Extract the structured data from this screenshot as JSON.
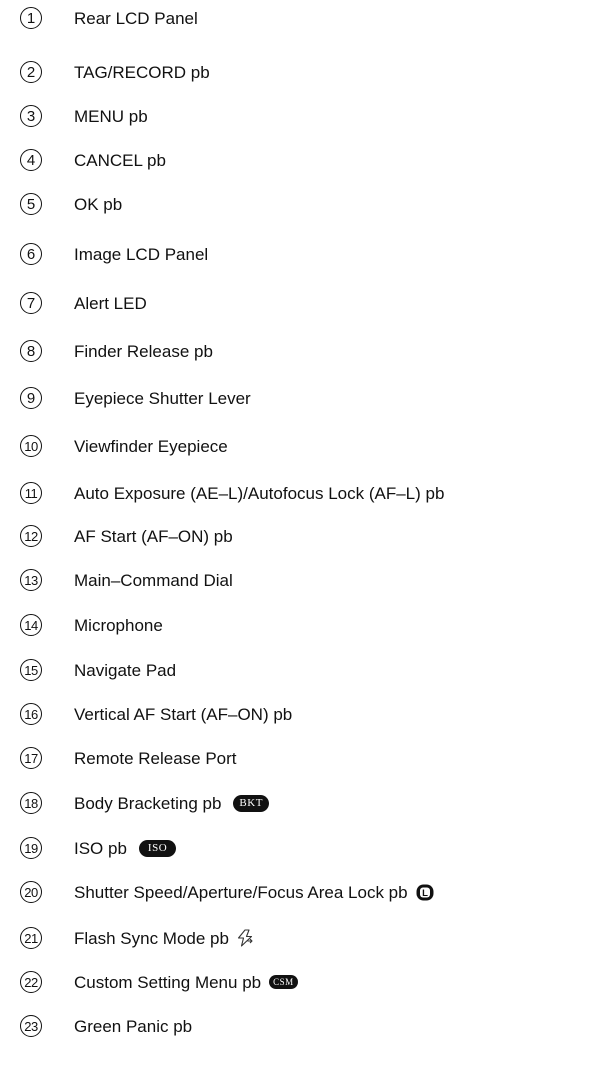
{
  "items": [
    {
      "n": "1",
      "label": "Rear LCD Panel"
    },
    {
      "n": "2",
      "label": "TAG/RECORD pb"
    },
    {
      "n": "3",
      "label": "MENU pb"
    },
    {
      "n": "4",
      "label": "CANCEL pb"
    },
    {
      "n": "5",
      "label": "OK pb"
    },
    {
      "n": "6",
      "label": "Image LCD Panel"
    },
    {
      "n": "7",
      "label": "Alert LED"
    },
    {
      "n": "8",
      "label": "Finder Release pb"
    },
    {
      "n": "9",
      "label": "Eyepiece Shutter Lever"
    },
    {
      "n": "10",
      "label": "Viewfinder Eyepiece"
    },
    {
      "n": "11",
      "label": "Auto Exposure (AE–L)/Autofocus Lock (AF–L) pb"
    },
    {
      "n": "12",
      "label": "AF Start (AF–ON) pb"
    },
    {
      "n": "13",
      "label": "Main–Command Dial"
    },
    {
      "n": "14",
      "label": "Microphone"
    },
    {
      "n": "15",
      "label": "Navigate Pad"
    },
    {
      "n": "16",
      "label": "Vertical AF Start (AF–ON) pb"
    },
    {
      "n": "17",
      "label": "Remote Release Port"
    },
    {
      "n": "18",
      "label": "Body Bracketing pb",
      "badge": "BKT",
      "icon": "bkt-badge-icon"
    },
    {
      "n": "19",
      "label": "ISO pb",
      "badge": "ISO",
      "icon": "iso-badge-icon"
    },
    {
      "n": "20",
      "label": "Shutter Speed/Aperture/Focus Area Lock pb",
      "badge": "L",
      "icon": "lock-l-icon"
    },
    {
      "n": "21",
      "label": "Flash Sync Mode pb",
      "icon": "flash-sync-icon"
    },
    {
      "n": "22",
      "label": "Custom Setting Menu pb",
      "badge": "CSM",
      "icon": "csm-badge-icon"
    },
    {
      "n": "23",
      "label": "Green Panic pb"
    }
  ]
}
